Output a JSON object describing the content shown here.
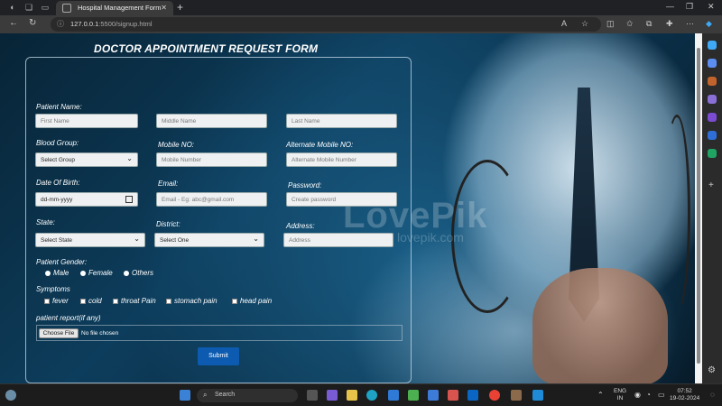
{
  "browser": {
    "tab_title": "Hospital Management Form",
    "url_host": "127.0.0.1",
    "url_path": ":5500/signup.html"
  },
  "watermark": {
    "main": "LovePik",
    "sub": "lovepik.com"
  },
  "form": {
    "title": "DOCTOR APPOINTMENT REQUEST FORM",
    "patient_name_label": "Patient Name:",
    "first_name_placeholder": "First Name",
    "middle_name_placeholder": "Middle Name",
    "last_name_placeholder": "Last Name",
    "blood_group_label": "Blood Group:",
    "blood_group_value": "Select Group",
    "mobile_label": "Mobile NO:",
    "mobile_placeholder": "Mobile Number",
    "alt_mobile_label": "Alternate Mobile NO:",
    "alt_mobile_placeholder": "Alternate Mobile Number",
    "dob_label": "Date Of Birth:",
    "dob_placeholder": "dd-mm-yyyy",
    "email_label": "Email:",
    "email_placeholder": "Email - Eg: abc@gmail.com",
    "password_label": "Password:",
    "password_placeholder": "Create password",
    "state_label": "State:",
    "state_value": "Select State",
    "district_label": "District:",
    "district_value": "Select One",
    "address_label": "Address:",
    "address_placeholder": "Address",
    "gender_label": "Patient Gender:",
    "gender_options": [
      "Male",
      "Female",
      "Others"
    ],
    "symptoms_label": "Symptoms",
    "symptoms": [
      "fever",
      "cold",
      "throat Pain",
      "stomach pain",
      "head pain"
    ],
    "report_label": "patient report(if any)",
    "file_button": "Choose File",
    "file_status": "No file chosen",
    "submit_label": "Submit"
  },
  "taskbar": {
    "search_placeholder": "Search",
    "lang_line1": "ENG",
    "lang_line2": "IN",
    "time": "07:52",
    "date": "19-02-2024"
  }
}
